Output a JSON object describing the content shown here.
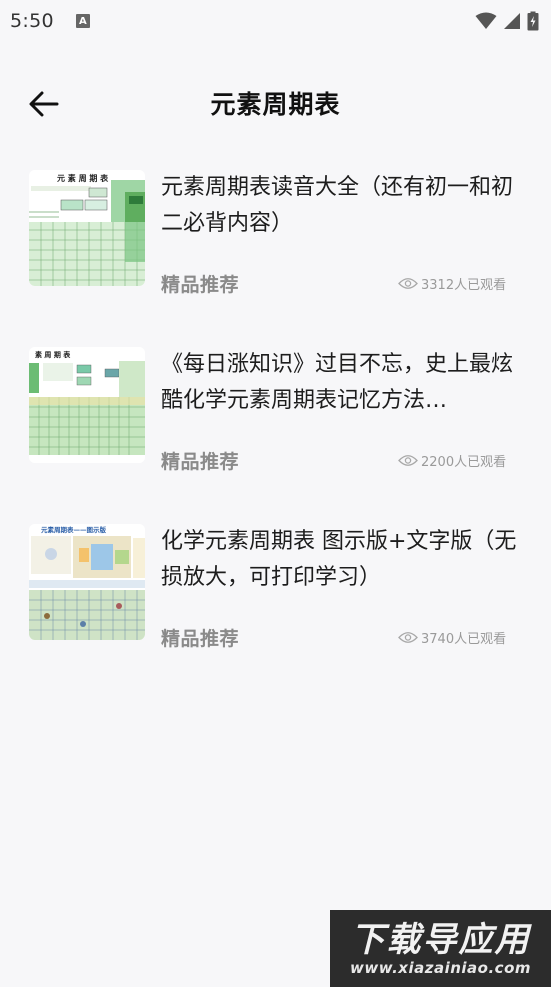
{
  "status": {
    "time": "5:50",
    "notification_letter": "A"
  },
  "header": {
    "title": "元素周期表"
  },
  "articles": [
    {
      "title": "元素周期表读音大全（还有初一和初二必背内容）",
      "tag": "精品推荐",
      "views": "3312人已观看",
      "thumb": {
        "heading": "元 素 周 期 表",
        "accent": "#5fae5f"
      }
    },
    {
      "title": "《每日涨知识》过目不忘，史上最炫酷化学元素周期表记忆方法…",
      "tag": "精品推荐",
      "views": "2200人已观看",
      "thumb": {
        "heading": "素 周 期 表",
        "accent": "#6cbc74"
      }
    },
    {
      "title": "化学元素周期表 图示版+文字版（无损放大，可打印学习）",
      "tag": "精品推荐",
      "views": "3740人已观看",
      "thumb": {
        "heading": "元素周期表——图示版",
        "accent": "#4a8fd0"
      }
    }
  ],
  "watermark": {
    "main": "下载导应用",
    "url": "www.xiazainiao.com"
  },
  "colors": {
    "background": "#f7f7f9",
    "tag_gray": "#8a8a8a",
    "views_gray": "#9a9a9a"
  }
}
